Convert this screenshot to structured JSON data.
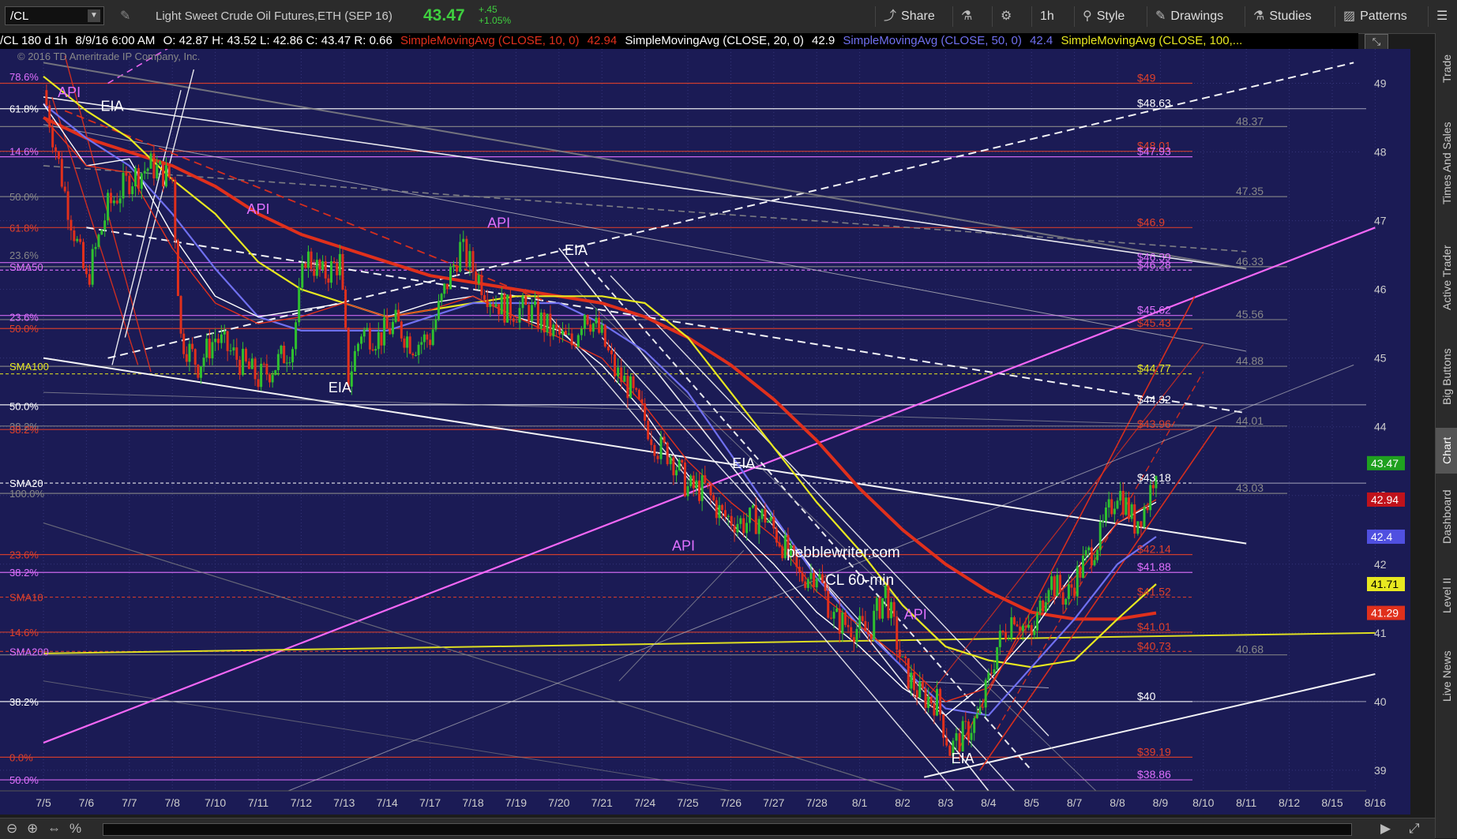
{
  "toolbar": {
    "symbol": "/CL",
    "description": "Light Sweet Crude Oil Futures,ETH (SEP 16)",
    "price": "43.47",
    "change": "+.45",
    "change_pct": "+1.05%",
    "share": "Share",
    "interval": "1h",
    "style": "Style",
    "drawings": "Drawings",
    "studies": "Studies",
    "patterns": "Patterns"
  },
  "legend": {
    "head": "/CL 180 d 1h",
    "date": "8/9/16 6:00 AM",
    "ohlc": "O: 42.87  H: 43.52  L: 42.86  C: 43.47  R: 0.66",
    "sma10": "SimpleMovingAvg (CLOSE, 10, 0)",
    "sma10_val": "42.94",
    "sma20": "SimpleMovingAvg (CLOSE, 20, 0)",
    "sma20_val": "42.9",
    "sma50": "SimpleMovingAvg (CLOSE, 50, 0)",
    "sma50_val": "42.4",
    "sma100": "SimpleMovingAvg (CLOSE, 100,..."
  },
  "sidebar": [
    "Trade",
    "Times And Sales",
    "Active Trader",
    "Big Buttons",
    "Chart",
    "Dashboard",
    "Level II",
    "Live News"
  ],
  "chart_data": {
    "type": "candlestick",
    "copyright": "© 2016 TD Ameritrade IP Company, Inc.",
    "watermark": [
      "pebblewriter.com",
      "CL 60-min"
    ],
    "x_labels": [
      "7/5",
      "7/6",
      "7/7",
      "7/8",
      "7/10",
      "7/11",
      "7/12",
      "7/13",
      "7/14",
      "7/17",
      "7/18",
      "7/19",
      "7/20",
      "7/21",
      "7/24",
      "7/25",
      "7/26",
      "7/27",
      "7/28",
      "8/1",
      "8/2",
      "8/3",
      "8/4",
      "8/5",
      "8/7",
      "8/8",
      "8/9",
      "8/10",
      "8/11",
      "8/12",
      "8/15",
      "8/16"
    ],
    "y_ticks": [
      39,
      40,
      41,
      42,
      43,
      44,
      45,
      46,
      47,
      48,
      49
    ],
    "ylim": [
      38.7,
      49.5
    ],
    "price_tags": [
      {
        "value": 43.47,
        "text": "43.47",
        "color": "#1fa01f"
      },
      {
        "value": 42.94,
        "text": "42.94",
        "color": "#c0121b"
      },
      {
        "value": 42.4,
        "text": "42.4",
        "color": "#5050e0"
      },
      {
        "value": 41.71,
        "text": "41.71",
        "color": "#e8e820"
      },
      {
        "value": 41.29,
        "text": "41.29",
        "color": "#e0301c"
      }
    ],
    "right_levels": [
      {
        "value": 49,
        "text": "$49",
        "color": "#e0402a"
      },
      {
        "value": 48.63,
        "text": "$48.63",
        "color": "#ffffff"
      },
      {
        "value": 48.37,
        "text": "48.37",
        "color": "#888888"
      },
      {
        "value": 48.01,
        "text": "$48.01",
        "color": "#e0402a"
      },
      {
        "value": 47.93,
        "text": "$47.93",
        "color": "#e070ff"
      },
      {
        "value": 47.35,
        "text": "47.35",
        "color": "#888888"
      },
      {
        "value": 46.9,
        "text": "$46.9",
        "color": "#e0402a"
      },
      {
        "value": 46.39,
        "text": "$46.39",
        "color": "#e070ff"
      },
      {
        "value": 46.28,
        "text": "$46.28",
        "color": "#e070ff"
      },
      {
        "value": 46.33,
        "text": "46.33",
        "color": "#888888"
      },
      {
        "value": 45.62,
        "text": "$45.62",
        "color": "#e070ff"
      },
      {
        "value": 45.56,
        "text": "45.56",
        "color": "#888888"
      },
      {
        "value": 45.43,
        "text": "$45.43",
        "color": "#e0402a"
      },
      {
        "value": 44.88,
        "text": "44.88",
        "color": "#888888"
      },
      {
        "value": 44.77,
        "text": "$44.77",
        "color": "#e8e820"
      },
      {
        "value": 44.32,
        "text": "$44.32",
        "color": "#ffffff"
      },
      {
        "value": 44.01,
        "text": "44.01",
        "color": "#888888"
      },
      {
        "value": 43.96,
        "text": "$43.96",
        "color": "#e0402a"
      },
      {
        "value": 43.18,
        "text": "$43.18",
        "color": "#ffffff"
      },
      {
        "value": 43.03,
        "text": "43.03",
        "color": "#888888"
      },
      {
        "value": 42.14,
        "text": "$42.14",
        "color": "#e0402a"
      },
      {
        "value": 41.88,
        "text": "$41.88",
        "color": "#e070ff"
      },
      {
        "value": 41.52,
        "text": "$41.52",
        "color": "#e0402a"
      },
      {
        "value": 41.01,
        "text": "$41.01",
        "color": "#e0402a"
      },
      {
        "value": 40.73,
        "text": "$40.73",
        "color": "#e0402a"
      },
      {
        "value": 40.68,
        "text": "40.68",
        "color": "#888888"
      },
      {
        "value": 40,
        "text": "$40",
        "color": "#ffffff"
      },
      {
        "value": 39.19,
        "text": "$39.19",
        "color": "#e0402a"
      },
      {
        "value": 38.86,
        "text": "$38.86",
        "color": "#e070ff"
      }
    ],
    "left_labels": [
      {
        "value": 49.1,
        "text": "78.6%",
        "color": "#e070ff"
      },
      {
        "value": 48.63,
        "text": "61.8%",
        "color": "#ffffff"
      },
      {
        "value": 48.01,
        "text": "14.6%",
        "color": "#e070ff"
      },
      {
        "value": 47.35,
        "text": "50.0%",
        "color": "#888888"
      },
      {
        "value": 46.9,
        "text": "61.8%",
        "color": "#e0402a"
      },
      {
        "value": 46.5,
        "text": "23.6%",
        "color": "#888888"
      },
      {
        "value": 46.33,
        "text": "SMA50",
        "color": "#e070ff"
      },
      {
        "value": 45.6,
        "text": "23.6%",
        "color": "#e070ff"
      },
      {
        "value": 45.43,
        "text": "50.0%",
        "color": "#e0402a"
      },
      {
        "value": 44.88,
        "text": "SMA100",
        "color": "#e8e820"
      },
      {
        "value": 44.3,
        "text": "50.0%",
        "color": "#ffffff"
      },
      {
        "value": 44.01,
        "text": "38.2%",
        "color": "#888888"
      },
      {
        "value": 43.96,
        "text": "38.2%",
        "color": "#e0402a"
      },
      {
        "value": 43.18,
        "text": "SMA20",
        "color": "#ffffff"
      },
      {
        "value": 43.03,
        "text": "100.0%",
        "color": "#888888"
      },
      {
        "value": 42.14,
        "text": "23.6%",
        "color": "#e0402a"
      },
      {
        "value": 41.88,
        "text": "38.2%",
        "color": "#e070ff"
      },
      {
        "value": 41.52,
        "text": "SMA10",
        "color": "#e0402a"
      },
      {
        "value": 41.01,
        "text": "14.6%",
        "color": "#e0402a"
      },
      {
        "value": 40.73,
        "text": "SMA200",
        "color": "#e070ff"
      },
      {
        "value": 40,
        "text": "38.2%",
        "color": "#ffffff"
      },
      {
        "value": 39.19,
        "text": "0.0%",
        "color": "#e0402a"
      },
      {
        "value": 38.86,
        "text": "50.0%",
        "color": "#e070ff"
      }
    ],
    "annotations": [
      {
        "text": "API",
        "x": 0.6,
        "y": 48.8,
        "color": "#e070ff"
      },
      {
        "text": "EIA",
        "x": 1.6,
        "y": 48.6,
        "color": "#ffffff"
      },
      {
        "text": "API",
        "x": 5.0,
        "y": 47.1,
        "color": "#e070ff"
      },
      {
        "text": "API",
        "x": 10.6,
        "y": 46.9,
        "color": "#e070ff"
      },
      {
        "text": "EIA",
        "x": 12.4,
        "y": 46.5,
        "color": "#ffffff"
      },
      {
        "text": "EIA",
        "x": 6.9,
        "y": 44.5,
        "color": "#ffffff"
      },
      {
        "text": "EIA",
        "x": 16.3,
        "y": 43.4,
        "color": "#ffffff"
      },
      {
        "text": "API",
        "x": 14.9,
        "y": 42.2,
        "color": "#e070ff"
      },
      {
        "text": "API",
        "x": 20.3,
        "y": 41.2,
        "color": "#e070ff"
      },
      {
        "text": "EIA",
        "x": 21.4,
        "y": 39.1,
        "color": "#ffffff"
      }
    ],
    "close_series": [
      [
        0,
        48.9
      ],
      [
        0.5,
        47.4
      ],
      [
        1.0,
        46.1
      ],
      [
        1.5,
        47.2
      ],
      [
        2.0,
        47.6
      ],
      [
        2.5,
        47.8
      ],
      [
        3.0,
        47.6
      ],
      [
        3.2,
        45.3
      ],
      [
        3.6,
        44.9
      ],
      [
        4.0,
        45.3
      ],
      [
        4.5,
        45.0
      ],
      [
        5.0,
        44.7
      ],
      [
        5.4,
        44.9
      ],
      [
        5.8,
        45.2
      ],
      [
        6.1,
        46.5
      ],
      [
        6.5,
        46.2
      ],
      [
        6.9,
        46.4
      ],
      [
        7.1,
        44.7
      ],
      [
        7.4,
        45.4
      ],
      [
        7.8,
        45.3
      ],
      [
        8.2,
        45.5
      ],
      [
        8.6,
        45.2
      ],
      [
        9.0,
        45.3
      ],
      [
        9.4,
        46.1
      ],
      [
        9.7,
        46.6
      ],
      [
        10.0,
        46.3
      ],
      [
        10.4,
        45.9
      ],
      [
        10.8,
        45.7
      ],
      [
        11.3,
        45.7
      ],
      [
        11.8,
        45.4
      ],
      [
        12.3,
        45.2
      ],
      [
        12.6,
        45.7
      ],
      [
        13.0,
        45.3
      ],
      [
        13.3,
        44.8
      ],
      [
        13.6,
        44.6
      ],
      [
        14.0,
        44.1
      ],
      [
        14.3,
        43.7
      ],
      [
        14.6,
        43.6
      ],
      [
        15.0,
        43.1
      ],
      [
        15.4,
        43.1
      ],
      [
        15.8,
        42.7
      ],
      [
        16.3,
        42.6
      ],
      [
        16.8,
        42.7
      ],
      [
        17.2,
        42.3
      ],
      [
        17.6,
        41.8
      ],
      [
        18.0,
        41.9
      ],
      [
        18.4,
        41.2
      ],
      [
        18.8,
        41.1
      ],
      [
        19.2,
        41.0
      ],
      [
        19.6,
        41.6
      ],
      [
        20.0,
        40.5
      ],
      [
        20.4,
        40.1
      ],
      [
        20.8,
        40.0
      ],
      [
        21.1,
        39.3
      ],
      [
        21.4,
        39.5
      ],
      [
        21.8,
        39.8
      ],
      [
        22.2,
        40.8
      ],
      [
        22.6,
        41.3
      ],
      [
        23.0,
        40.9
      ],
      [
        23.4,
        41.8
      ],
      [
        23.8,
        41.5
      ],
      [
        24.2,
        42.0
      ],
      [
        24.6,
        42.4
      ],
      [
        25.0,
        43.1
      ],
      [
        25.4,
        42.6
      ],
      [
        25.7,
        42.9
      ],
      [
        25.9,
        43.47
      ]
    ],
    "sma10_series": [
      [
        0,
        48.5
      ],
      [
        1,
        47.8
      ],
      [
        2,
        47.7
      ],
      [
        3,
        46.6
      ],
      [
        4,
        45.8
      ],
      [
        5,
        45.5
      ],
      [
        6,
        45.6
      ],
      [
        7,
        45.8
      ],
      [
        8,
        45.6
      ],
      [
        9,
        45.7
      ],
      [
        10,
        45.9
      ],
      [
        11,
        45.6
      ],
      [
        12,
        45.3
      ],
      [
        13,
        45.0
      ],
      [
        14,
        44.3
      ],
      [
        15,
        43.5
      ],
      [
        16,
        42.9
      ],
      [
        17,
        42.4
      ],
      [
        18,
        41.6
      ],
      [
        19,
        41.1
      ],
      [
        20,
        40.6
      ],
      [
        21,
        40.0
      ],
      [
        22,
        40.2
      ],
      [
        23,
        41.2
      ],
      [
        24,
        41.8
      ],
      [
        25,
        42.6
      ],
      [
        25.9,
        42.94
      ]
    ],
    "sma20_series": [
      [
        0,
        48.7
      ],
      [
        1,
        47.8
      ],
      [
        2,
        47.9
      ],
      [
        3,
        46.8
      ],
      [
        4,
        45.9
      ],
      [
        5,
        45.6
      ],
      [
        6,
        45.7
      ],
      [
        7,
        45.8
      ],
      [
        8,
        45.6
      ],
      [
        9,
        45.8
      ],
      [
        10,
        45.9
      ],
      [
        11,
        45.6
      ],
      [
        12,
        45.4
      ],
      [
        13,
        44.9
      ],
      [
        14,
        44.2
      ],
      [
        15,
        43.3
      ],
      [
        16,
        42.6
      ],
      [
        17,
        42.0
      ],
      [
        18,
        41.3
      ],
      [
        19,
        40.8
      ],
      [
        20,
        40.2
      ],
      [
        21,
        39.8
      ],
      [
        22,
        40.3
      ],
      [
        23,
        41.0
      ],
      [
        24,
        41.9
      ],
      [
        25,
        42.6
      ],
      [
        25.9,
        42.9
      ]
    ],
    "sma50_series": [
      [
        0,
        48.7
      ],
      [
        1,
        48.2
      ],
      [
        2,
        47.8
      ],
      [
        3,
        47.1
      ],
      [
        4,
        46.3
      ],
      [
        5,
        45.6
      ],
      [
        6,
        45.4
      ],
      [
        7,
        45.4
      ],
      [
        8,
        45.4
      ],
      [
        9,
        45.6
      ],
      [
        10,
        45.8
      ],
      [
        11,
        45.8
      ],
      [
        12,
        45.8
      ],
      [
        13,
        45.5
      ],
      [
        14,
        45.1
      ],
      [
        15,
        44.5
      ],
      [
        16,
        43.6
      ],
      [
        17,
        42.7
      ],
      [
        18,
        41.8
      ],
      [
        19,
        41.1
      ],
      [
        20,
        40.5
      ],
      [
        21,
        39.9
      ],
      [
        22,
        39.8
      ],
      [
        23,
        40.5
      ],
      [
        24,
        41.2
      ],
      [
        25,
        42.0
      ],
      [
        25.9,
        42.4
      ]
    ],
    "sma100_series": [
      [
        0,
        49.1
      ],
      [
        1,
        48.6
      ],
      [
        2,
        48.2
      ],
      [
        3,
        47.6
      ],
      [
        4,
        47.1
      ],
      [
        5,
        46.4
      ],
      [
        6,
        46.0
      ],
      [
        7,
        45.8
      ],
      [
        8,
        45.6
      ],
      [
        9,
        45.7
      ],
      [
        10,
        45.8
      ],
      [
        11,
        45.9
      ],
      [
        12,
        45.9
      ],
      [
        13,
        45.9
      ],
      [
        14,
        45.8
      ],
      [
        15,
        45.3
      ],
      [
        16,
        44.5
      ],
      [
        17,
        43.7
      ],
      [
        18,
        42.9
      ],
      [
        19,
        42.2
      ],
      [
        20,
        41.4
      ],
      [
        21,
        40.8
      ],
      [
        22,
        40.6
      ],
      [
        23,
        40.5
      ],
      [
        24,
        40.6
      ],
      [
        25,
        41.2
      ],
      [
        25.9,
        41.71
      ]
    ],
    "sma200_series": [
      [
        0,
        48.5
      ],
      [
        1,
        48.2
      ],
      [
        2,
        48.0
      ],
      [
        3,
        47.8
      ],
      [
        4,
        47.5
      ],
      [
        5,
        47.1
      ],
      [
        6,
        46.8
      ],
      [
        7,
        46.6
      ],
      [
        8,
        46.4
      ],
      [
        9,
        46.2
      ],
      [
        10,
        46.1
      ],
      [
        11,
        46.0
      ],
      [
        12,
        45.9
      ],
      [
        13,
        45.8
      ],
      [
        14,
        45.6
      ],
      [
        15,
        45.3
      ],
      [
        16,
        44.9
      ],
      [
        17,
        44.4
      ],
      [
        18,
        43.8
      ],
      [
        19,
        43.1
      ],
      [
        20,
        42.5
      ],
      [
        21,
        42.0
      ],
      [
        22,
        41.6
      ],
      [
        23,
        41.3
      ],
      [
        24,
        41.2
      ],
      [
        25,
        41.2
      ],
      [
        25.9,
        41.29
      ]
    ],
    "colors": {
      "background": "#1b1b55",
      "up": "#2fc02f",
      "down": "#e0301c",
      "sma10": "#e0301c",
      "sma20": "#ffffff",
      "sma50": "#7070f0",
      "sma100": "#e8e820",
      "fib_pink": "#e070ff",
      "fib_red": "#e0402a",
      "trend_white": "#ffffff"
    }
  }
}
